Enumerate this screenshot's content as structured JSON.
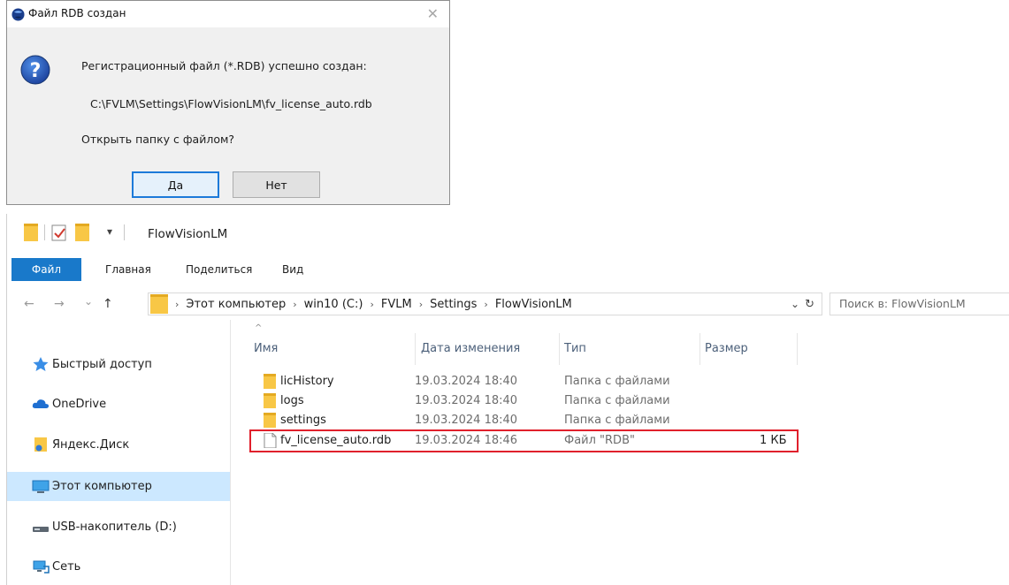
{
  "dialog": {
    "title": "Файл RDB создан",
    "close_glyph": "✕",
    "message": "Регистрационный файл (*.RDB) успешно создан:",
    "path": "C:\\FVLM\\Settings\\FlowVisionLM\\fv_license_auto.rdb",
    "question": "Открыть папку с файлом?",
    "yes_label": "Да",
    "no_label": "Нет",
    "icon": "question-icon"
  },
  "explorer": {
    "title": "FlowVisionLM",
    "qat_dropdown": "▾",
    "tabs": [
      "Файл",
      "Главная",
      "Поделиться",
      "Вид"
    ],
    "nav": {
      "back": "←",
      "forward": "→",
      "recent": "⌄",
      "up": "↑"
    },
    "breadcrumb": [
      "Этот компьютер",
      "win10 (C:)",
      "FVLM",
      "Settings",
      "FlowVisionLM"
    ],
    "crumb_separator": "›",
    "addr_dropdown": "⌄",
    "refresh": "↻",
    "search_placeholder": "Поиск в: FlowVisionLM",
    "sidebar": [
      {
        "label": "Быстрый доступ",
        "icon": "star-icon"
      },
      {
        "label": "OneDrive",
        "icon": "cloud-icon"
      },
      {
        "label": "Яндекс.Диск",
        "icon": "yandex-disk-icon"
      },
      {
        "label": "Этот компьютер",
        "icon": "monitor-icon",
        "selected": true
      },
      {
        "label": "USB-накопитель (D:)",
        "icon": "usb-drive-icon"
      },
      {
        "label": "Сеть",
        "icon": "network-icon"
      }
    ],
    "columns": {
      "name": "Имя",
      "sort_glyph": "^",
      "date": "Дата изменения",
      "type": "Тип",
      "size": "Размер"
    },
    "files": [
      {
        "name": "licHistory",
        "date": "19.03.2024 18:40",
        "type": "Папка с файлами",
        "size": "",
        "kind": "folder"
      },
      {
        "name": "logs",
        "date": "19.03.2024 18:40",
        "type": "Папка с файлами",
        "size": "",
        "kind": "folder"
      },
      {
        "name": "settings",
        "date": "19.03.2024 18:40",
        "type": "Папка с файлами",
        "size": "",
        "kind": "folder"
      },
      {
        "name": "fv_license_auto.rdb",
        "date": "19.03.2024 18:46",
        "type": "Файл \"RDB\"",
        "size": "1 КБ",
        "kind": "file",
        "highlighted": true
      }
    ]
  },
  "colors": {
    "accent": "#1979ca",
    "selection": "#cce8ff",
    "highlight_border": "#e0202c",
    "folder": "#f8c746"
  }
}
